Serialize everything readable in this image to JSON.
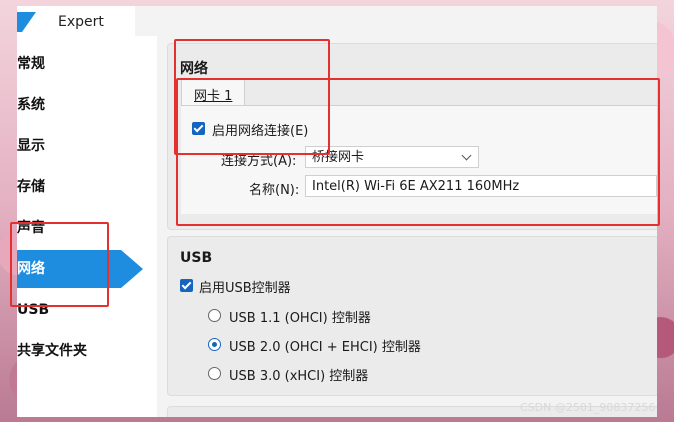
{
  "window": {
    "mode_label": "Expert"
  },
  "sidebar": {
    "items": [
      {
        "label": "常规"
      },
      {
        "label": "系统"
      },
      {
        "label": "显示"
      },
      {
        "label": "存储"
      },
      {
        "label": "声音"
      },
      {
        "label": "网络",
        "active": true
      },
      {
        "label": "USB"
      },
      {
        "label": "共享文件夹"
      }
    ]
  },
  "network": {
    "title": "网络",
    "tab_label": "网卡 1",
    "enable_label": "启用网络连接(E)",
    "enable_checked": true,
    "attached_label": "连接方式(A):",
    "attached_value": "桥接网卡",
    "name_label": "名称(N):",
    "name_value": "Intel(R) Wi-Fi 6E AX211 160MHz"
  },
  "usb": {
    "title": "USB",
    "enable_label": "启用USB控制器",
    "enable_checked": true,
    "options": [
      {
        "label": "USB 1.1 (OHCI) 控制器",
        "selected": false
      },
      {
        "label": "USB 2.0 (OHCI + EHCI) 控制器",
        "selected": true
      },
      {
        "label": "USB 3.0 (xHCI) 控制器",
        "selected": false
      }
    ]
  },
  "watermark": "CSDN @2501_90837256",
  "colors": {
    "accent": "#1e8de0",
    "highlight": "#e53030",
    "checkbox": "#1565c0"
  }
}
